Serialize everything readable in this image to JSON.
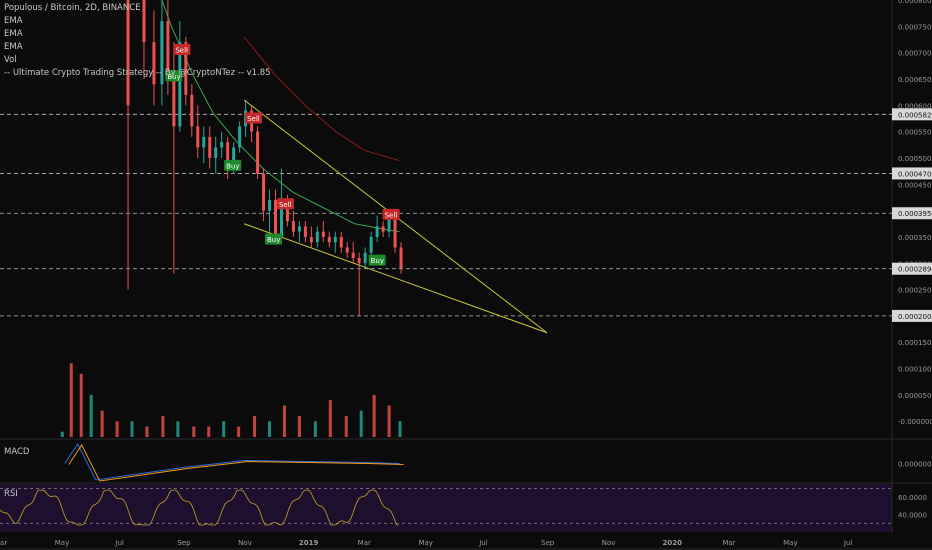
{
  "header": {
    "title": "Populous / Bitcoin, 2D, BINANCE",
    "indicators": [
      "EMA",
      "EMA",
      "EMA",
      "Vol",
      "-- Ultimate Crypto Trading Strategy -- By @CryptoNTez -- v1.85"
    ]
  },
  "panes": {
    "macd_label": "MACD",
    "rsi_label": "RSI"
  },
  "colors": {
    "background": "#0b0b0b",
    "up": "#26a69a",
    "down": "#ef5350",
    "ema_green": "#3fa34d",
    "ema_red": "#8b1a1a",
    "trendline": "#c8c83a",
    "rsi_line": "#c9a227",
    "rsi_band": "#1e0f2e",
    "macd_line": "#2f6bdc",
    "signal_line": "#f39c12",
    "label_text": "#9a9a9a",
    "buy": "#1f8a2c",
    "sell": "#c62828"
  },
  "chart_data": {
    "type": "candlestick",
    "symbol": "Populous / Bitcoin",
    "interval": "2D",
    "exchange": "BINANCE",
    "x_ticks": [
      "Mar",
      "May",
      "Jul",
      "Sep",
      "Nov",
      "2019",
      "Mar",
      "May",
      "Jul",
      "Sep",
      "Nov",
      "2020",
      "Mar",
      "May",
      "Jul"
    ],
    "price_ticks": [
      "0.0008000",
      "0.0007500",
      "0.0007000",
      "0.0006500",
      "0.0006000",
      "0.0005500",
      "0.0005000",
      "0.0004500",
      "0.0004000",
      "0.0003500",
      "0.0003000",
      "0.0002500",
      "0.0002000",
      "0.0001500",
      "0.0001000",
      "0.0000500",
      "-0.0000000"
    ],
    "price_range": [
      -3e-05,
      0.0008
    ],
    "levels": [
      "0.0005829",
      "0.0004706",
      "0.0003950",
      "0.0002896",
      "0.0002000"
    ],
    "macd_tick": "0.0000000",
    "rsi_ticks": [
      "60.0000",
      "40.0000"
    ],
    "rsi_range": [
      20,
      75
    ],
    "rsi_levels": [
      70,
      30
    ],
    "signals": [
      {
        "label": "Sell",
        "date": "2018-08-30",
        "price": 0.000705
      },
      {
        "label": "Buy",
        "date": "2018-08-22",
        "price": 0.000655
      },
      {
        "label": "Sell",
        "date": "2018-11-10",
        "price": 0.000575
      },
      {
        "label": "Buy",
        "date": "2018-10-20",
        "price": 0.000485
      },
      {
        "label": "Sell",
        "date": "2018-12-12",
        "price": 0.000412
      },
      {
        "label": "Buy",
        "date": "2018-11-30",
        "price": 0.000345
      },
      {
        "label": "Sell",
        "date": "2019-03-28",
        "price": 0.000392
      },
      {
        "label": "Buy",
        "date": "2019-03-14",
        "price": 0.000305
      }
    ],
    "wedge": {
      "upper": [
        [
          "2018-11-01",
          0.00061
        ],
        [
          "2019-09-01",
          0.000168
        ]
      ],
      "lower": [
        [
          "2018-11-01",
          0.000375
        ],
        [
          "2019-09-01",
          0.000168
        ]
      ]
    },
    "candles": [
      [
        "2018-07-06",
        0.00085,
        0.0009,
        0.00025,
        0.0006
      ],
      [
        "2018-07-22",
        0.00085,
        0.00088,
        0.00065,
        0.00072
      ],
      [
        "2018-08-01",
        0.00072,
        0.00078,
        0.0006,
        0.00064
      ],
      [
        "2018-08-09",
        0.00064,
        0.0008,
        0.0006,
        0.00076
      ],
      [
        "2018-08-15",
        0.00076,
        0.0008,
        0.00062,
        0.00065
      ],
      [
        "2018-08-21",
        0.00065,
        0.00072,
        0.00028,
        0.00056
      ],
      [
        "2018-08-27",
        0.00056,
        0.00076,
        0.00055,
        0.00072
      ],
      [
        "2018-09-02",
        0.00072,
        0.00073,
        0.0006,
        0.00062
      ],
      [
        "2018-09-08",
        0.00062,
        0.00064,
        0.00054,
        0.00056
      ],
      [
        "2018-09-14",
        0.00056,
        0.0006,
        0.0005,
        0.00052
      ],
      [
        "2018-09-20",
        0.00052,
        0.00056,
        0.00049,
        0.00054
      ],
      [
        "2018-09-26",
        0.00054,
        0.00056,
        0.00048,
        0.0005
      ],
      [
        "2018-10-02",
        0.0005,
        0.00054,
        0.00047,
        0.00052
      ],
      [
        "2018-10-08",
        0.00052,
        0.00055,
        0.0005,
        0.00053
      ],
      [
        "2018-10-14",
        0.00053,
        0.00054,
        0.00046,
        0.00048
      ],
      [
        "2018-10-20",
        0.00048,
        0.00053,
        0.00047,
        0.00052
      ],
      [
        "2018-10-26",
        0.00052,
        0.00057,
        0.00051,
        0.00056
      ],
      [
        "2018-11-01",
        0.00056,
        0.00061,
        0.00054,
        0.00059
      ],
      [
        "2018-11-07",
        0.00059,
        0.0006,
        0.00053,
        0.00055
      ],
      [
        "2018-11-13",
        0.00055,
        0.00056,
        0.00046,
        0.00047
      ],
      [
        "2018-11-19",
        0.00047,
        0.00048,
        0.00038,
        0.0004
      ],
      [
        "2018-11-25",
        0.0004,
        0.00044,
        0.00036,
        0.00042
      ],
      [
        "2018-12-01",
        0.00042,
        0.00044,
        0.00034,
        0.00035
      ],
      [
        "2018-12-07",
        0.00035,
        0.00048,
        0.00034,
        0.00042
      ],
      [
        "2018-12-13",
        0.00042,
        0.00043,
        0.00037,
        0.00038
      ],
      [
        "2018-12-19",
        0.00038,
        0.0004,
        0.00035,
        0.00036
      ],
      [
        "2018-12-25",
        0.00036,
        0.00038,
        0.00034,
        0.00037
      ],
      [
        "2018-12-31",
        0.00037,
        0.00038,
        0.00034,
        0.00035
      ],
      [
        "2019-01-06",
        0.00035,
        0.00037,
        0.00033,
        0.00034
      ],
      [
        "2019-01-12",
        0.00034,
        0.00037,
        0.00033,
        0.00036
      ],
      [
        "2019-01-18",
        0.00036,
        0.00038,
        0.00034,
        0.00035
      ],
      [
        "2019-01-24",
        0.00035,
        0.00036,
        0.00033,
        0.00034
      ],
      [
        "2019-01-30",
        0.00034,
        0.00036,
        0.00032,
        0.00035
      ],
      [
        "2019-02-05",
        0.00035,
        0.00036,
        0.00032,
        0.00033
      ],
      [
        "2019-02-11",
        0.00033,
        0.00034,
        0.00031,
        0.00032
      ],
      [
        "2019-02-17",
        0.00032,
        0.00034,
        0.0003,
        0.00031
      ],
      [
        "2019-02-23",
        0.00031,
        0.00032,
        0.0002,
        0.0003
      ],
      [
        "2019-03-01",
        0.0003,
        0.00033,
        0.00029,
        0.00032
      ],
      [
        "2019-03-07",
        0.00032,
        0.00036,
        0.00031,
        0.00035
      ],
      [
        "2019-03-13",
        0.00035,
        0.00039,
        0.00034,
        0.00037
      ],
      [
        "2019-03-19",
        0.00037,
        0.00038,
        0.00035,
        0.00036
      ],
      [
        "2019-03-25",
        0.00036,
        0.0004,
        0.00035,
        0.00039
      ],
      [
        "2019-03-31",
        0.00039,
        0.000395,
        0.00032,
        0.00033
      ],
      [
        "2019-04-06",
        0.00033,
        0.00034,
        0.00028,
        0.00029
      ]
    ],
    "volume": [
      [
        "2018-05-01",
        1e-05
      ],
      [
        "2018-05-10",
        0.00014
      ],
      [
        "2018-05-20",
        0.00012
      ],
      [
        "2018-05-30",
        8e-05
      ],
      [
        "2018-06-10",
        5e-05
      ],
      [
        "2018-06-25",
        3e-05
      ],
      [
        "2018-07-10",
        3e-05
      ],
      [
        "2018-07-25",
        2e-05
      ],
      [
        "2018-08-10",
        4e-05
      ],
      [
        "2018-08-25",
        3e-05
      ],
      [
        "2018-09-10",
        2e-05
      ],
      [
        "2018-09-25",
        2e-05
      ],
      [
        "2018-10-10",
        3e-05
      ],
      [
        "2018-10-25",
        2e-05
      ],
      [
        "2018-11-10",
        4e-05
      ],
      [
        "2018-11-25",
        3e-05
      ],
      [
        "2018-12-10",
        6e-05
      ],
      [
        "2018-12-25",
        4e-05
      ],
      [
        "2019-01-10",
        3e-05
      ],
      [
        "2019-01-25",
        7e-05
      ],
      [
        "2019-02-10",
        4e-05
      ],
      [
        "2019-02-25",
        5e-05
      ],
      [
        "2019-03-10",
        8e-05
      ],
      [
        "2019-03-25",
        6e-05
      ],
      [
        "2019-04-05",
        3e-05
      ]
    ],
    "ema_green": [
      [
        "2018-08-01",
        0.00085
      ],
      [
        "2018-08-20",
        0.00075
      ],
      [
        "2018-09-10",
        0.00066
      ],
      [
        "2018-10-01",
        0.000585
      ],
      [
        "2018-10-25",
        0.00053
      ],
      [
        "2018-11-20",
        0.00048
      ],
      [
        "2018-12-20",
        0.000435
      ],
      [
        "2019-01-20",
        0.000405
      ],
      [
        "2019-02-20",
        0.000375
      ],
      [
        "2019-03-20",
        0.000365
      ],
      [
        "2019-04-06",
        0.00036
      ]
    ],
    "ema_red": [
      [
        "2018-11-01",
        0.00073
      ],
      [
        "2018-12-01",
        0.00066
      ],
      [
        "2019-01-01",
        0.0006
      ],
      [
        "2019-02-01",
        0.00055
      ],
      [
        "2019-03-01",
        0.000515
      ],
      [
        "2019-04-06",
        0.000495
      ]
    ]
  }
}
